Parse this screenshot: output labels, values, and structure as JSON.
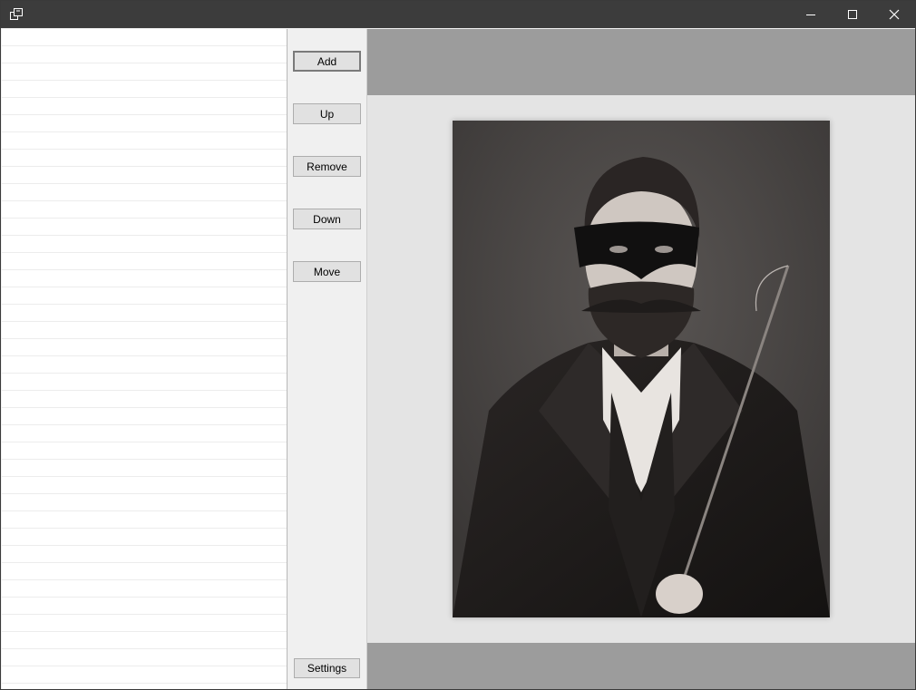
{
  "window": {
    "title": "",
    "controls": {
      "minimize": "minimize-icon",
      "maximize": "maximize-icon",
      "close": "close-icon"
    }
  },
  "list": {
    "items": []
  },
  "buttons": {
    "add": "Add",
    "up": "Up",
    "remove": "Remove",
    "down": "Down",
    "move": "Move",
    "settings": "Settings"
  },
  "preview": {
    "image_description": "sepia portrait of a bearded man in a black eye mask and dark coat holding a riding crop",
    "colors": {
      "viewer_bg": "#9c9c9c",
      "paper_bg": "#e4e4e4"
    }
  }
}
